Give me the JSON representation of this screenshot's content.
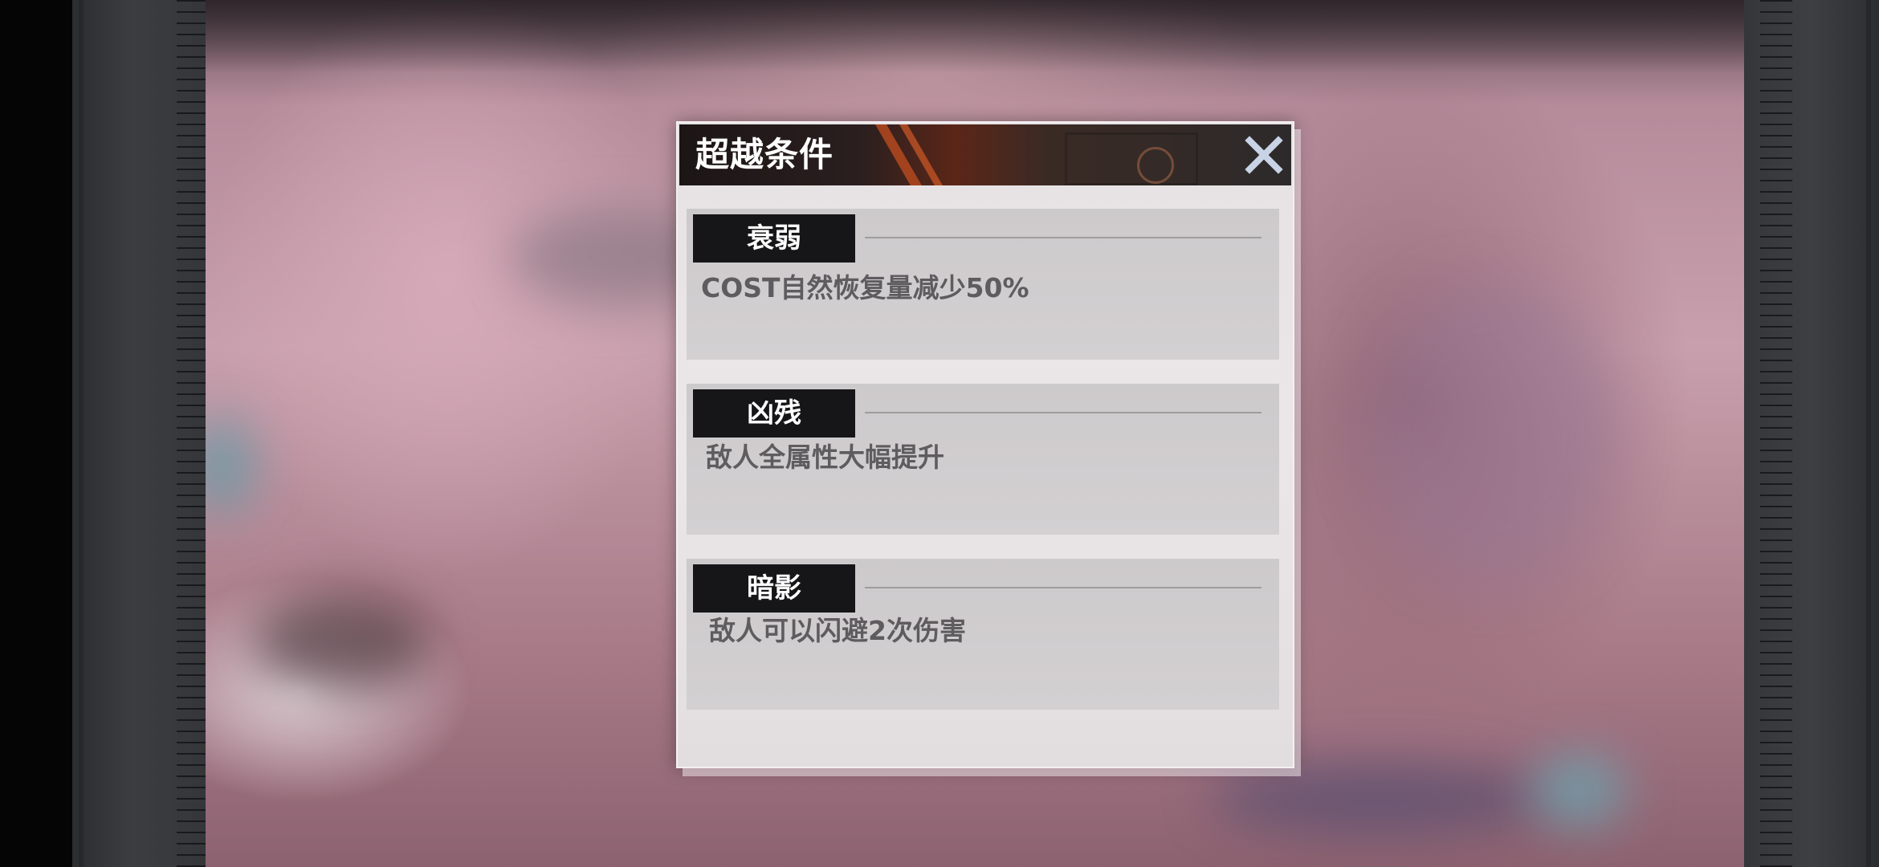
{
  "dialog": {
    "title": "超越条件",
    "close_icon": "close-icon"
  },
  "conditions": [
    {
      "name": "衰弱",
      "description": "COST自然恢复量减少50%"
    },
    {
      "name": "凶残",
      "description": "敌人全属性大幅提升"
    },
    {
      "name": "暗影",
      "description": "敌人可以闪避2次伤害"
    }
  ],
  "colors": {
    "tag_background": "#161618",
    "card_background": "#cdcacc",
    "description_text": "#5e5c5f",
    "header_accent": "#b4491f"
  }
}
